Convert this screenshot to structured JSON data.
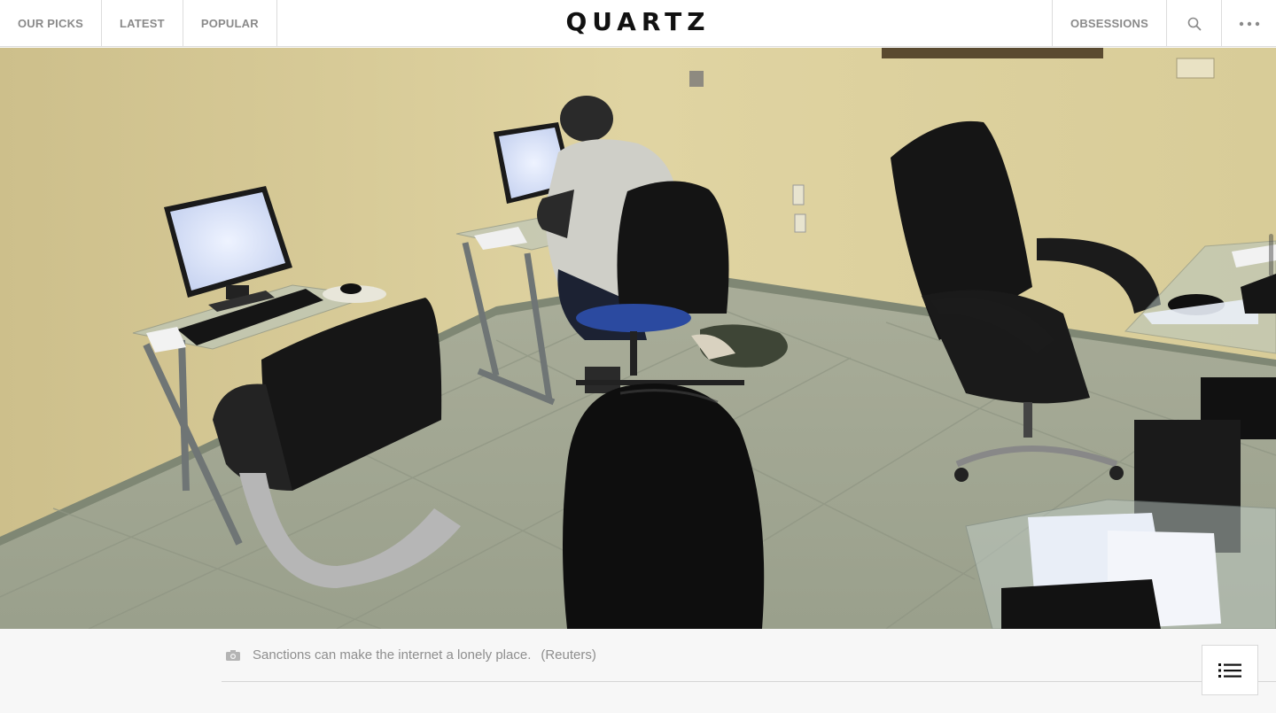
{
  "nav": {
    "left_items": [
      "OUR PICKS",
      "LATEST",
      "POPULAR"
    ],
    "logo": "QUARTZ",
    "right_item": "OBSESSIONS"
  },
  "icons": {
    "search": "search-icon",
    "more": "more-dots-icon",
    "camera": "camera-icon",
    "toc": "list-icon"
  },
  "hero": {
    "description": "Cuban internet cafe with computers and office chairs"
  },
  "caption": {
    "text": "Sanctions can make the internet a lonely place.",
    "credit": "(Reuters)"
  },
  "colors": {
    "nav_text": "#8a8a8a",
    "logo": "#111111",
    "caption": "#8e8e8e",
    "wall": "#d9cc98",
    "floor": "#a8ab98"
  }
}
